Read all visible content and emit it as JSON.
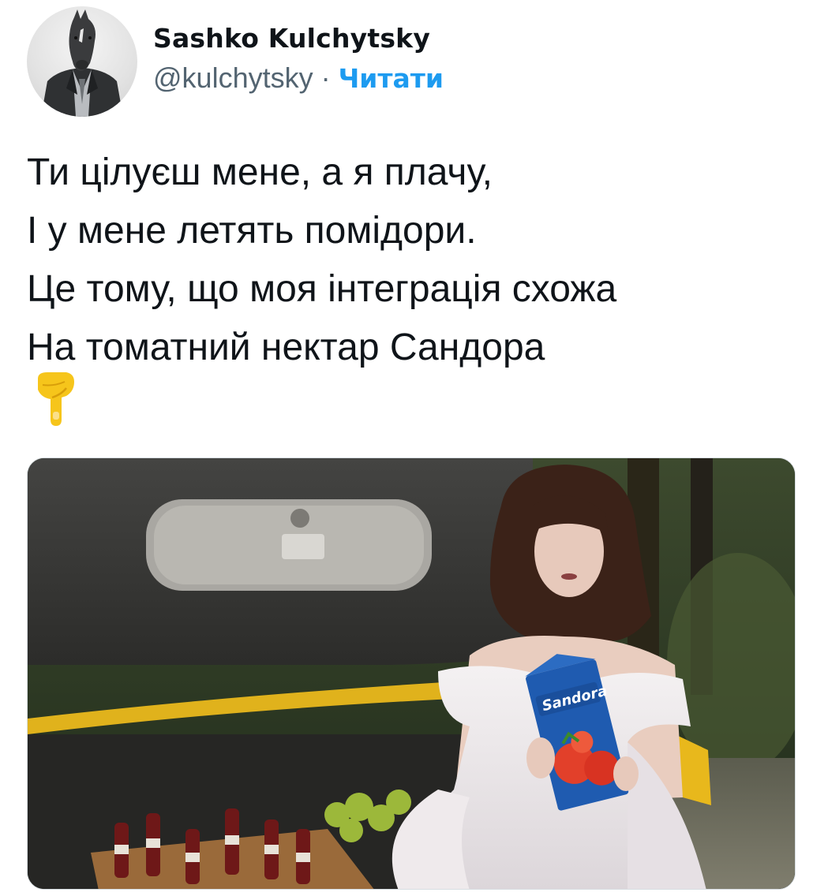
{
  "author": {
    "display_name": "Sashko Kulchytsky",
    "handle": "@kulchytsky",
    "separator": "·",
    "follow_label": "Читати",
    "avatar_icon": "horse-head-avatar"
  },
  "tweet": {
    "lines": [
      "Ти цілуєш мене, а я плачу,",
      "І у мене летять помідори.",
      "Це тому, що моя інтеграція схожа",
      "На томатний нектар Сандора"
    ],
    "emoji": "pointing-down-emoji"
  },
  "media": {
    "description_icon": "photo-bride-with-juice-carton",
    "brand_text": "Sandora"
  },
  "colors": {
    "link": "#1d9bf0",
    "secondary": "#536471",
    "text": "#0f1419"
  }
}
